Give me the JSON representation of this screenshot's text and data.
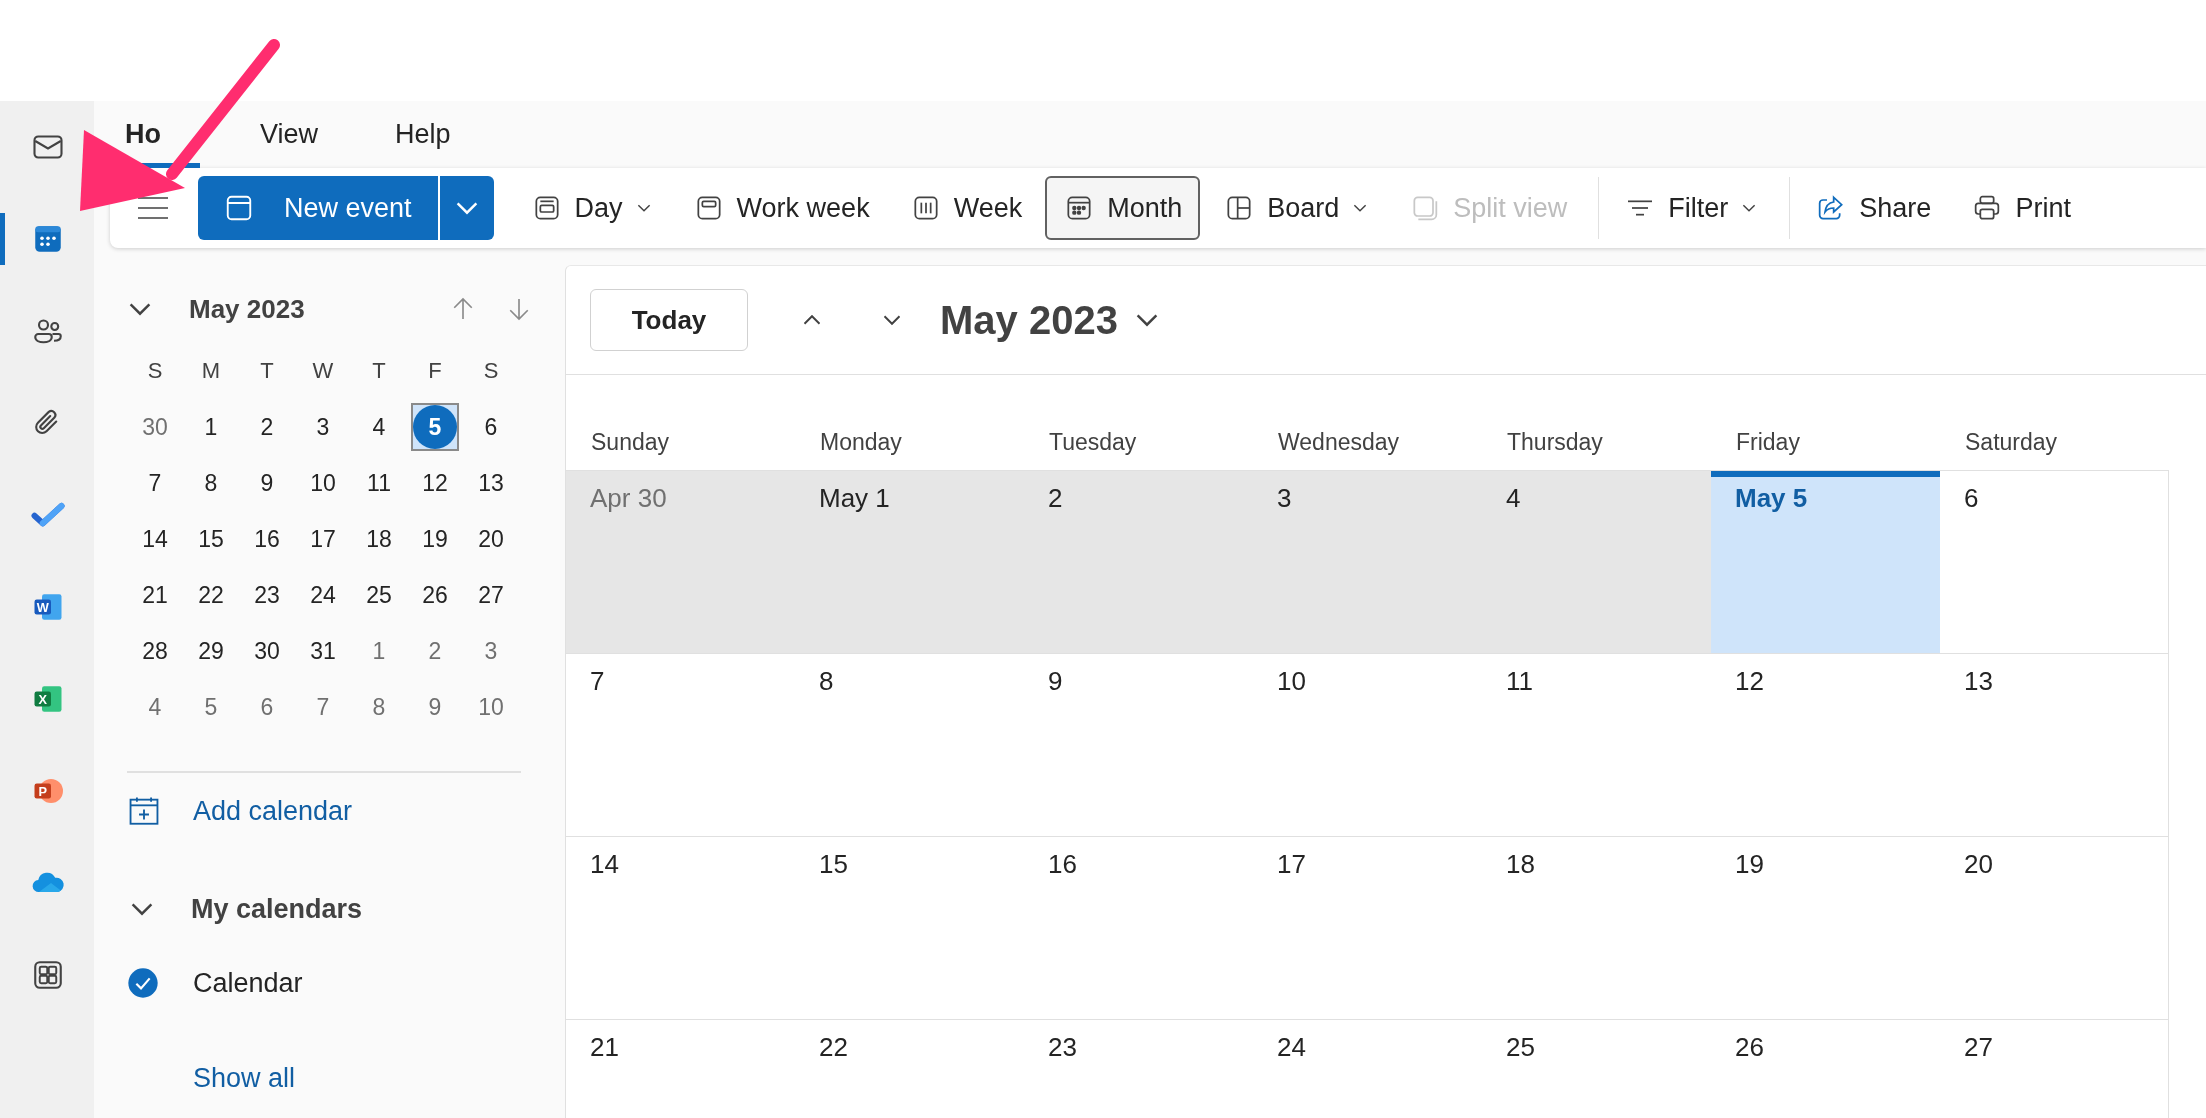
{
  "rail": {
    "items": [
      {
        "kind": "mail",
        "selected": false
      },
      {
        "kind": "calendar",
        "selected": true
      },
      {
        "kind": "people",
        "selected": false
      },
      {
        "kind": "files",
        "selected": false
      },
      {
        "kind": "todo",
        "selected": false
      },
      {
        "kind": "word",
        "letter": "W",
        "selected": false
      },
      {
        "kind": "excel",
        "letter": "X",
        "selected": false
      },
      {
        "kind": "powerpoint",
        "letter": "P",
        "selected": false
      },
      {
        "kind": "onedrive",
        "selected": false
      },
      {
        "kind": "apps",
        "selected": false
      }
    ]
  },
  "tabs": [
    {
      "label": "Ho",
      "selected": true
    },
    {
      "label": "View",
      "selected": false
    },
    {
      "label": "Help",
      "selected": false
    }
  ],
  "toolbar": {
    "new_event": {
      "label": "New event"
    },
    "groups": [
      [
        {
          "kind": "day",
          "label": "Day",
          "dropdown": true,
          "selected": false,
          "disabled": false
        },
        {
          "kind": "work_week",
          "label": "Work week",
          "dropdown": false,
          "selected": false,
          "disabled": false
        },
        {
          "kind": "week",
          "label": "Week",
          "dropdown": false,
          "selected": false,
          "disabled": false
        },
        {
          "kind": "month",
          "label": "Month",
          "dropdown": false,
          "selected": true,
          "disabled": false
        },
        {
          "kind": "board",
          "label": "Board",
          "dropdown": true,
          "selected": false,
          "disabled": false
        },
        {
          "kind": "split",
          "label": "Split view",
          "dropdown": false,
          "selected": false,
          "disabled": true
        }
      ],
      [
        {
          "kind": "filter",
          "label": "Filter",
          "dropdown": true,
          "selected": false,
          "disabled": false
        }
      ],
      [
        {
          "kind": "share",
          "label": "Share",
          "dropdown": false,
          "selected": false,
          "disabled": false
        },
        {
          "kind": "print",
          "label": "Print",
          "dropdown": false,
          "selected": false,
          "disabled": false
        }
      ]
    ]
  },
  "mini_calendar": {
    "title": "May 2023",
    "weekdays": [
      "S",
      "M",
      "T",
      "W",
      "T",
      "F",
      "S"
    ],
    "weeks": [
      [
        {
          "label": "30",
          "muted": true,
          "selected": false
        },
        {
          "label": "1",
          "muted": false,
          "selected": false
        },
        {
          "label": "2",
          "muted": false,
          "selected": false
        },
        {
          "label": "3",
          "muted": false,
          "selected": false
        },
        {
          "label": "4",
          "muted": false,
          "selected": false
        },
        {
          "label": "5",
          "muted": false,
          "selected": true
        },
        {
          "label": "6",
          "muted": false,
          "selected": false
        }
      ],
      [
        {
          "label": "7",
          "muted": false,
          "selected": false
        },
        {
          "label": "8",
          "muted": false,
          "selected": false
        },
        {
          "label": "9",
          "muted": false,
          "selected": false
        },
        {
          "label": "10",
          "muted": false,
          "selected": false
        },
        {
          "label": "11",
          "muted": false,
          "selected": false
        },
        {
          "label": "12",
          "muted": false,
          "selected": false
        },
        {
          "label": "13",
          "muted": false,
          "selected": false
        }
      ],
      [
        {
          "label": "14",
          "muted": false,
          "selected": false
        },
        {
          "label": "15",
          "muted": false,
          "selected": false
        },
        {
          "label": "16",
          "muted": false,
          "selected": false
        },
        {
          "label": "17",
          "muted": false,
          "selected": false
        },
        {
          "label": "18",
          "muted": false,
          "selected": false
        },
        {
          "label": "19",
          "muted": false,
          "selected": false
        },
        {
          "label": "20",
          "muted": false,
          "selected": false
        }
      ],
      [
        {
          "label": "21",
          "muted": false,
          "selected": false
        },
        {
          "label": "22",
          "muted": false,
          "selected": false
        },
        {
          "label": "23",
          "muted": false,
          "selected": false
        },
        {
          "label": "24",
          "muted": false,
          "selected": false
        },
        {
          "label": "25",
          "muted": false,
          "selected": false
        },
        {
          "label": "26",
          "muted": false,
          "selected": false
        },
        {
          "label": "27",
          "muted": false,
          "selected": false
        }
      ],
      [
        {
          "label": "28",
          "muted": false,
          "selected": false
        },
        {
          "label": "29",
          "muted": false,
          "selected": false
        },
        {
          "label": "30",
          "muted": false,
          "selected": false
        },
        {
          "label": "31",
          "muted": false,
          "selected": false
        },
        {
          "label": "1",
          "muted": true,
          "selected": false
        },
        {
          "label": "2",
          "muted": true,
          "selected": false
        },
        {
          "label": "3",
          "muted": true,
          "selected": false
        }
      ],
      [
        {
          "label": "4",
          "muted": true,
          "selected": false
        },
        {
          "label": "5",
          "muted": true,
          "selected": false
        },
        {
          "label": "6",
          "muted": true,
          "selected": false
        },
        {
          "label": "7",
          "muted": true,
          "selected": false
        },
        {
          "label": "8",
          "muted": true,
          "selected": false
        },
        {
          "label": "9",
          "muted": true,
          "selected": false
        },
        {
          "label": "10",
          "muted": true,
          "selected": false
        }
      ]
    ]
  },
  "calendars": {
    "add_calendar": "Add calendar",
    "section": {
      "title": "My calendars",
      "expanded": true
    },
    "items": [
      {
        "label": "Calendar",
        "checked": true
      }
    ],
    "show_all": "Show all"
  },
  "calendar": {
    "today_button": "Today",
    "title": "May 2023",
    "weekdays": [
      "Sunday",
      "Monday",
      "Tuesday",
      "Wednesday",
      "Thursday",
      "Friday",
      "Saturday"
    ],
    "weeks": [
      [
        {
          "label": "Apr 30",
          "muted": true,
          "shaded": true,
          "today": false
        },
        {
          "label": "May 1",
          "muted": false,
          "shaded": true,
          "today": false
        },
        {
          "label": "2",
          "muted": false,
          "shaded": true,
          "today": false
        },
        {
          "label": "3",
          "muted": false,
          "shaded": true,
          "today": false
        },
        {
          "label": "4",
          "muted": false,
          "shaded": true,
          "today": false
        },
        {
          "label": "May 5",
          "muted": false,
          "shaded": false,
          "today": true
        },
        {
          "label": "6",
          "muted": false,
          "shaded": false,
          "today": false
        }
      ],
      [
        {
          "label": "7",
          "muted": false,
          "shaded": false,
          "today": false
        },
        {
          "label": "8",
          "muted": false,
          "shaded": false,
          "today": false
        },
        {
          "label": "9",
          "muted": false,
          "shaded": false,
          "today": false
        },
        {
          "label": "10",
          "muted": false,
          "shaded": false,
          "today": false
        },
        {
          "label": "11",
          "muted": false,
          "shaded": false,
          "today": false
        },
        {
          "label": "12",
          "muted": false,
          "shaded": false,
          "today": false
        },
        {
          "label": "13",
          "muted": false,
          "shaded": false,
          "today": false
        }
      ],
      [
        {
          "label": "14",
          "muted": false,
          "shaded": false,
          "today": false
        },
        {
          "label": "15",
          "muted": false,
          "shaded": false,
          "today": false
        },
        {
          "label": "16",
          "muted": false,
          "shaded": false,
          "today": false
        },
        {
          "label": "17",
          "muted": false,
          "shaded": false,
          "today": false
        },
        {
          "label": "18",
          "muted": false,
          "shaded": false,
          "today": false
        },
        {
          "label": "19",
          "muted": false,
          "shaded": false,
          "today": false
        },
        {
          "label": "20",
          "muted": false,
          "shaded": false,
          "today": false
        }
      ],
      [
        {
          "label": "21",
          "muted": false,
          "shaded": false,
          "today": false
        },
        {
          "label": "22",
          "muted": false,
          "shaded": false,
          "today": false
        },
        {
          "label": "23",
          "muted": false,
          "shaded": false,
          "today": false
        },
        {
          "label": "24",
          "muted": false,
          "shaded": false,
          "today": false
        },
        {
          "label": "25",
          "muted": false,
          "shaded": false,
          "today": false
        },
        {
          "label": "26",
          "muted": false,
          "shaded": false,
          "today": false
        },
        {
          "label": "27",
          "muted": false,
          "shaded": false,
          "today": false
        }
      ]
    ]
  }
}
